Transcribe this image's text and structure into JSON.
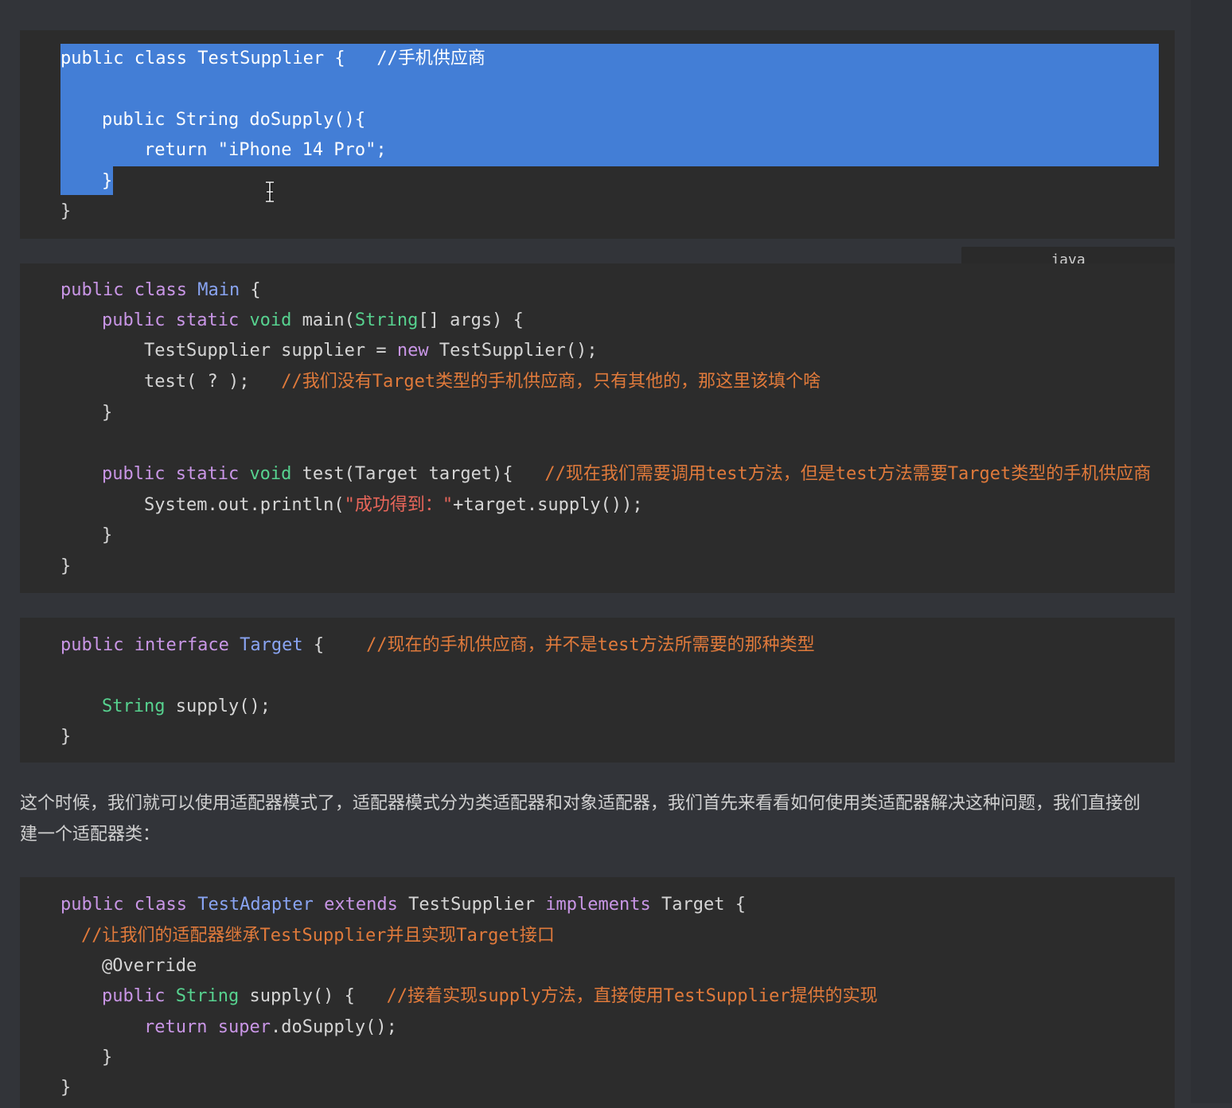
{
  "block1": {
    "lines": [
      {
        "kw": "public class",
        "name": "TestSupplier",
        "rest": " {",
        "comment": "//手机供应商"
      },
      {
        "a": "public String doSupply(){"
      },
      {
        "a": "return ",
        "s": "\"iPhone 14 Pro\"",
        "b": ";"
      },
      {
        "a": "}"
      },
      {
        "a": "}"
      }
    ]
  },
  "lang_label": "java",
  "block2": {
    "l1_kw": "public class",
    "l1_name": "Main",
    "l1_rest": " {",
    "l2_kw": "public static",
    "l2_void": "void",
    "l2_fn": " main(",
    "l2_type": "String",
    "l2_rest": "[] args) {",
    "l3_a": "TestSupplier supplier = ",
    "l3_new": "new",
    "l3_b": " TestSupplier();",
    "l4_a": "test( ? );",
    "l4_comment": "//我们没有Target类型的手机供应商，只有其他的，那这里该填个啥",
    "l5": "}",
    "l6_kw": "public static",
    "l6_void": "void",
    "l6_rest": " test(Target target){",
    "l6_comment": "//现在我们需要调用test方法，但是test方法需要Target类型的手机供应商",
    "l7_a": "System.out.println(",
    "l7_str": "\"成功得到：\"",
    "l7_b": "+target.supply());",
    "l8": "}",
    "l9": "}"
  },
  "block3": {
    "l1_kw": "public interface",
    "l1_name": "Target",
    "l1_rest": " {",
    "l1_comment": "//现在的手机供应商，并不是test方法所需要的那种类型",
    "l2_type": "String",
    "l2_rest": " supply();",
    "l3": "}"
  },
  "paragraph": "这个时候，我们就可以使用适配器模式了，适配器模式分为类适配器和对象适配器，我们首先来看看如何使用类适配器解决这种问题，我们直接创建一个适配器类：",
  "block4": {
    "l1_kw": "public class",
    "l1_name": "TestAdapter",
    "l1_ext": "extends",
    "l1_sup": " TestSupplier ",
    "l1_impl": "implements",
    "l1_rest": " Target {",
    "l2_comment": "//让我们的适配器继承TestSupplier并且实现Target接口",
    "l3": "@Override",
    "l4_kw": "public",
    "l4_type": "String",
    "l4_rest": " supply() {",
    "l4_comment": "//接着实现supply方法，直接使用TestSupplier提供的实现",
    "l5_kw": "return",
    "l5_super": "super",
    "l5_rest": ".doSupply();",
    "l6": "}",
    "l7": "}"
  },
  "colors": {
    "background": "#323439",
    "code_bg": "#2c2c2c",
    "selection": "#437ed6",
    "keyword": "#c996e6",
    "type": "#57d28f",
    "class_name": "#89a4f2",
    "comment": "#e07a3b",
    "string": "#e8665a"
  }
}
